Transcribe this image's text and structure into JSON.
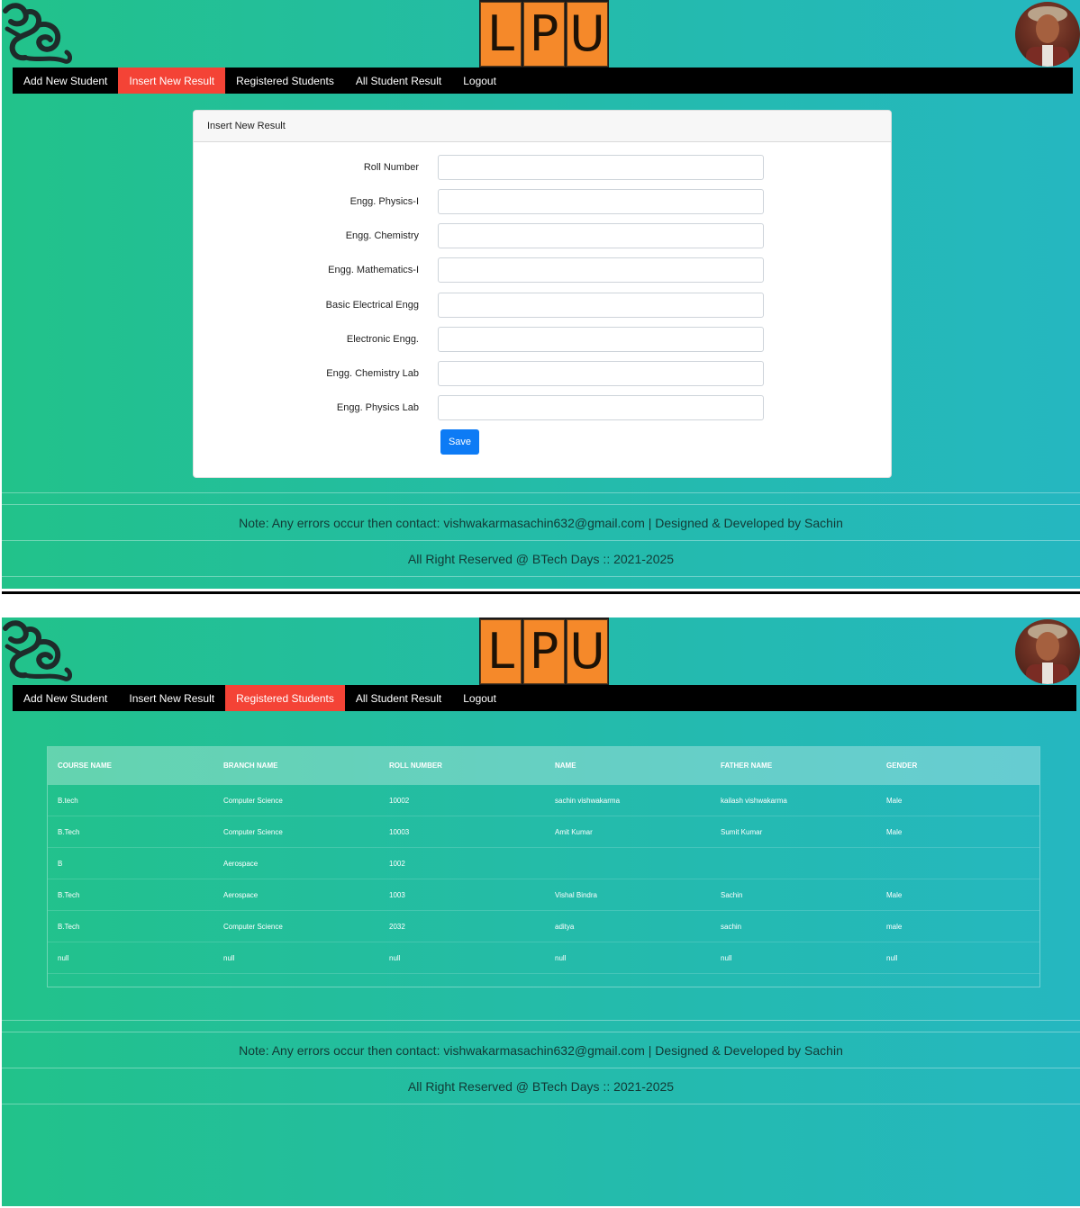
{
  "screens": [
    {
      "nav": [
        "Add New Student",
        "Insert New Result",
        "Registered Students",
        "All Student Result",
        "Logout"
      ],
      "active_nav": 1,
      "card_title": "Insert New Result",
      "fields": [
        {
          "label": "Roll Number",
          "value": ""
        },
        {
          "label": "Engg. Physics-I",
          "value": ""
        },
        {
          "label": "Engg. Chemistry",
          "value": ""
        },
        {
          "label": "Engg. Mathematics-I",
          "value": ""
        },
        {
          "label": "Basic Electrical Engg",
          "value": ""
        },
        {
          "label": "Electronic Engg.",
          "value": ""
        },
        {
          "label": "Engg. Chemistry Lab",
          "value": ""
        },
        {
          "label": "Engg. Physics Lab",
          "value": ""
        }
      ],
      "save_label": "Save"
    },
    {
      "nav": [
        "Add New Student",
        "Insert New Result",
        "Registered Students",
        "All Student Result",
        "Logout"
      ],
      "active_nav": 2,
      "table": {
        "headers": [
          "COURSE NAME",
          "BRANCH NAME",
          "ROLL NUMBER",
          "NAME",
          "FATHER NAME",
          "GENDER"
        ],
        "rows": [
          [
            "B.tech",
            "Computer Science",
            "10002",
            "sachin vishwakarma",
            "kailash vishwakarma",
            "Male"
          ],
          [
            "B.Tech",
            "Computer Science",
            "10003",
            "Amit Kumar",
            "Sumit Kumar",
            "Male"
          ],
          [
            "B",
            "Aerospace",
            "1002",
            "",
            "",
            ""
          ],
          [
            "B.Tech",
            "Aerospace",
            "1003",
            "Vishal Bindra",
            "Sachin",
            "Male"
          ],
          [
            "B.Tech",
            "Computer Science",
            "2032",
            "aditya",
            "sachin",
            "male"
          ],
          [
            "null",
            "null",
            "null",
            "null",
            "null",
            "null"
          ]
        ]
      }
    }
  ],
  "brand": {
    "letters": [
      "L",
      "P",
      "U"
    ],
    "brand_color": "#f5892a"
  },
  "footer": {
    "note": "Note: Any errors occur then contact: vishwakarmasachin632@gmail.com | Designed & Developed by Sachin",
    "rights": "All Right Reserved @ BTech Days :: 2021-2025"
  },
  "colors": {
    "nav_active": "#f44336",
    "save_button": "#0d7bf5",
    "gradient_start": "#22c28a",
    "gradient_end": "#25b7c0"
  },
  "icons": {
    "left_logo": "ornamental-logo-icon",
    "avatar": "user-avatar"
  }
}
